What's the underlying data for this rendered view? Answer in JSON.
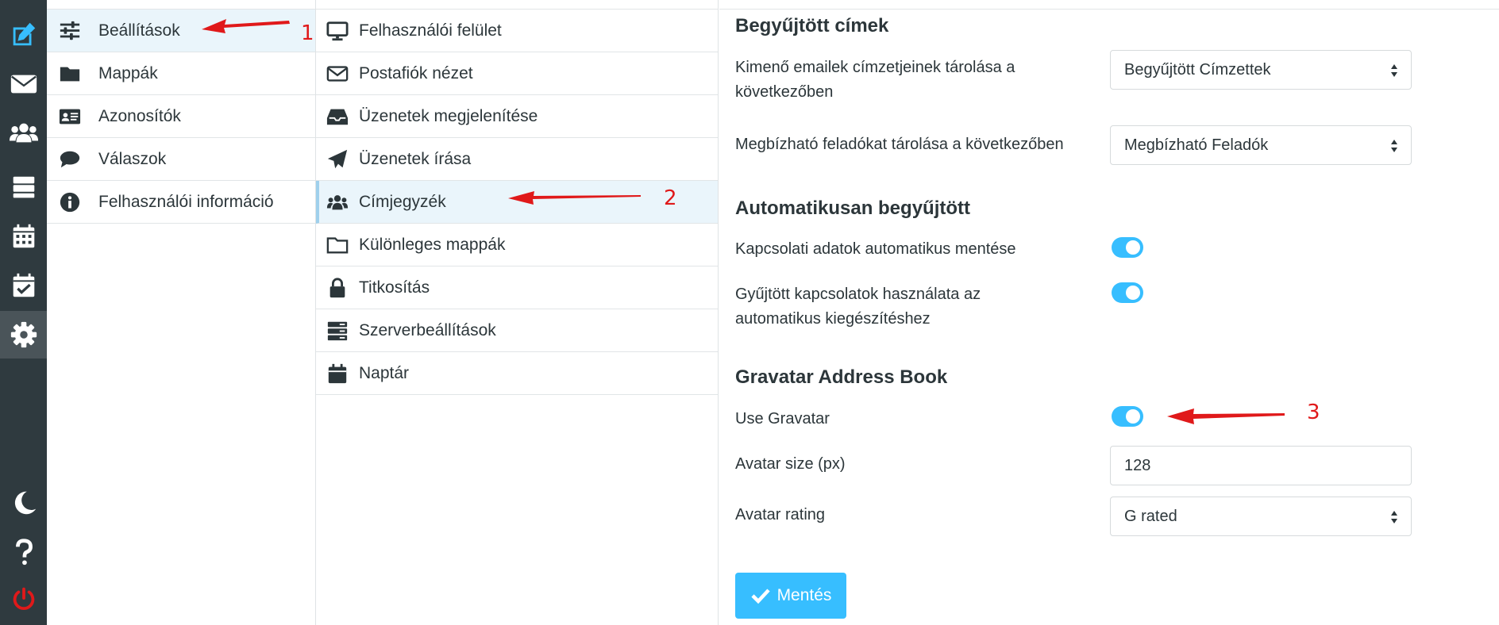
{
  "rail": {
    "items": [
      {
        "name": "compose-icon",
        "active": false
      },
      {
        "name": "mail-icon",
        "active": false
      },
      {
        "name": "contacts-icon",
        "active": false
      },
      {
        "name": "server-icon",
        "active": false
      },
      {
        "name": "calendar-icon",
        "active": false
      },
      {
        "name": "tasks-icon",
        "active": false
      },
      {
        "name": "gear-icon",
        "active": true
      },
      {
        "name": "moon-icon",
        "active": false
      },
      {
        "name": "help-icon",
        "active": false
      },
      {
        "name": "power-icon",
        "active": false
      }
    ]
  },
  "settings_nav": {
    "items": [
      {
        "label": "Beállítások",
        "icon": "sliders-icon",
        "selected": true
      },
      {
        "label": "Mappák",
        "icon": "folder-icon",
        "selected": false
      },
      {
        "label": "Azonosítók",
        "icon": "id-card-icon",
        "selected": false
      },
      {
        "label": "Válaszok",
        "icon": "comment-icon",
        "selected": false
      },
      {
        "label": "Felhasználói információ",
        "icon": "info-icon",
        "selected": false
      }
    ]
  },
  "sections_nav": {
    "items": [
      {
        "label": "Felhasználói felület",
        "icon": "monitor-icon",
        "selected": false
      },
      {
        "label": "Postafiók nézet",
        "icon": "envelope-icon",
        "selected": false
      },
      {
        "label": "Üzenetek megjelenítése",
        "icon": "inbox-icon",
        "selected": false
      },
      {
        "label": "Üzenetek írása",
        "icon": "paper-plane-icon",
        "selected": false
      },
      {
        "label": "Címjegyzék",
        "icon": "users-icon",
        "selected": true
      },
      {
        "label": "Különleges mappák",
        "icon": "folder-open-icon",
        "selected": false
      },
      {
        "label": "Titkosítás",
        "icon": "lock-icon",
        "selected": false
      },
      {
        "label": "Szerverbeállítások",
        "icon": "server-icon",
        "selected": false
      },
      {
        "label": "Naptár",
        "icon": "calendar-icon",
        "selected": false
      }
    ]
  },
  "content": {
    "section1": {
      "title": "Begyűjtött címek",
      "row1_label": "Kimenő emailek címzetjeinek tárolása a következőben",
      "row1_value": "Begyűjtött Címzettek",
      "row2_label": "Megbízható feladókat tárolása a következőben",
      "row2_value": "Megbízható Feladók"
    },
    "section2": {
      "title": "Automatikusan begyűjtött",
      "row1_label": "Kapcsolati adatok automatikus mentése",
      "row1_on": true,
      "row2_label": "Gyűjtött kapcsolatok használata az automatikus kiegészítéshez",
      "row2_on": true
    },
    "section3": {
      "title": "Gravatar Address Book",
      "row1_label": "Use Gravatar",
      "row1_on": true,
      "row2_label": "Avatar size (px)",
      "row2_value": "128",
      "row3_label": "Avatar rating",
      "row3_value": "G rated"
    },
    "save_label": "Mentés"
  },
  "annotations": {
    "color": "#e0191a",
    "labels": [
      "1",
      "2",
      "3"
    ]
  },
  "colors": {
    "rail_bg": "#2f3a3f",
    "accent": "#37beff",
    "selected_bg": "#eaf5fb",
    "power": "#e0191a"
  }
}
